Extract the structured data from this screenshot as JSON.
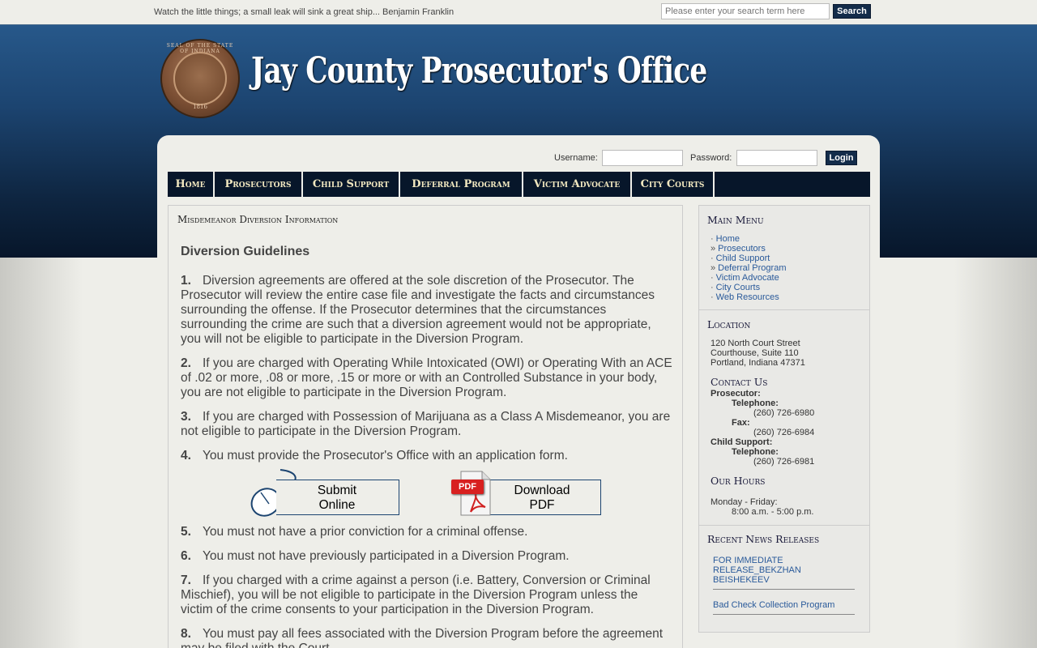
{
  "topbar": {
    "quote": "Watch the little things; a small leak will sink a great ship... Benjamin Franklin",
    "search_placeholder": "Please enter your search term here",
    "search_button": "Search"
  },
  "header": {
    "title": "Jay County Prosecutor's Office",
    "seal_ring": "SEAL OF THE STATE OF INDIANA",
    "seal_year": "1816"
  },
  "login": {
    "username_label": "Username:",
    "password_label": "Password:",
    "button": "Login"
  },
  "nav": [
    "Home",
    "Prosecutors",
    "Child Support",
    "Deferral Program",
    "Victim Advocate",
    "City Courts"
  ],
  "content": {
    "page_title": "Misdemeanor Diversion Information",
    "heading": "Diversion Guidelines",
    "items": [
      {
        "num": "1.",
        "text": "Diversion agreements are offered at the sole discretion of the Prosecutor. The Prosecutor will review the entire case file and investigate the facts and circumstances surrounding the offense.  If the Prosecutor determines that the circumstances surrounding the crime are such that a diversion agreement would not be appropriate, you will not be eligible to participate in the Diversion Program."
      },
      {
        "num": "2.",
        "text": "If you are charged with Operating While Intoxicated (OWI) or Operating With an ACE of .02 or more, .08 or more, .15 or more or with an Controlled Substance in your body, you are not eligible to participate in the Diversion Program."
      },
      {
        "num": "3.",
        "text": "If you are charged with Possession of Marijuana as a Class A Misdemeanor, you are not eligible to participate in the Diversion Program."
      },
      {
        "num": "4.",
        "text": "You must provide the Prosecutor's Office with an application form."
      },
      {
        "num": "5.",
        "text": "You must not have a prior conviction for a criminal offense."
      },
      {
        "num": "6.",
        "text": "You must not have previously participated in a Diversion Program."
      },
      {
        "num": "7.",
        "text": "If you charged with a crime against a person (i.e. Battery, Conversion or Criminal Mischief), you will be not eligible to participate in the Diversion Program unless the victim of the crime consents to your participation in the Diversion Program."
      },
      {
        "num": "8.",
        "text": "You must pay all fees associated with the Diversion Program before the agreement may be filed with the Court."
      }
    ],
    "submit_online": "Submit Online",
    "download_pdf": "Download PDF",
    "pdf_badge": "PDF"
  },
  "sidebar": {
    "main_menu_title": "Main Menu",
    "menu": [
      {
        "bullet": "·",
        "label": "Home"
      },
      {
        "bullet": "»",
        "label": "Prosecutors"
      },
      {
        "bullet": "·",
        "label": "Child Support"
      },
      {
        "bullet": "»",
        "label": "Deferral Program"
      },
      {
        "bullet": "·",
        "label": "Victim Advocate"
      },
      {
        "bullet": "·",
        "label": "City Courts"
      },
      {
        "bullet": "·",
        "label": "Web Resources"
      }
    ],
    "location_title": "Location",
    "address": [
      "120 North Court Street",
      "Courthouse, Suite 110",
      "Portland, Indiana 47371"
    ],
    "contact_title": "Contact Us",
    "prosecutor_label": "Prosecutor:",
    "telephone_label": "Telephone:",
    "fax_label": "Fax:",
    "prosecutor_phone": "(260) 726-6980",
    "prosecutor_fax": "(260) 726-6984",
    "child_support_label": "Child Support:",
    "child_support_phone": "(260) 726-6981",
    "hours_title": "Our Hours",
    "hours_days": "Monday - Friday:",
    "hours_time": "8:00 a.m. - 5:00 p.m.",
    "news_title": "Recent News Releases",
    "news": [
      "FOR IMMEDIATE RELEASE_BEKZHAN BEISHEKEEV",
      "Bad Check Collection Program"
    ]
  },
  "colors": {
    "nav_bg": "#07162a",
    "header_top": "#27588a",
    "link": "#2a5a9a",
    "button": "#132c4a"
  }
}
